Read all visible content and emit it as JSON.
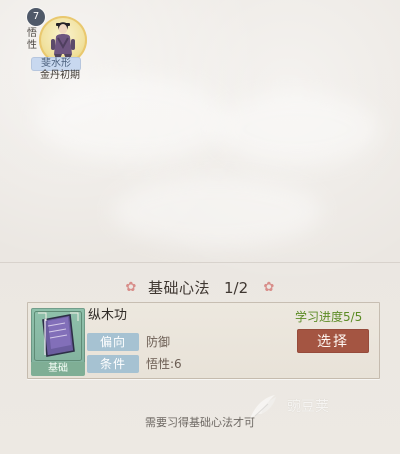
{
  "character": {
    "level": "7",
    "attribute": "悟性",
    "name": "斐水形",
    "realm": "金丹初期"
  },
  "section": {
    "title": "基础心法",
    "count": "1/2"
  },
  "skill": {
    "name": "纵木功",
    "book_tag": "基础",
    "direction_label": "偏向",
    "direction_value": "防御",
    "condition_label": "条件",
    "condition_value": "悟性:6",
    "progress": "学习进度5/5",
    "action": "选择"
  },
  "notice": "需要习得基础心法才可",
  "watermark": "豌豆荚",
  "colors": {
    "background": "#ebe7e2",
    "card": "#ebe6dd",
    "accent_button": "#a45542",
    "label_blue": "#a6c2d2",
    "tag_green": "#7fae95",
    "progress_green": "#5b8b24",
    "name_tag": "#c8d8ef"
  },
  "icons": {
    "petal_left": "flower-icon",
    "petal_right": "flower-icon",
    "book": "book-icon",
    "portrait": "character-portrait"
  }
}
